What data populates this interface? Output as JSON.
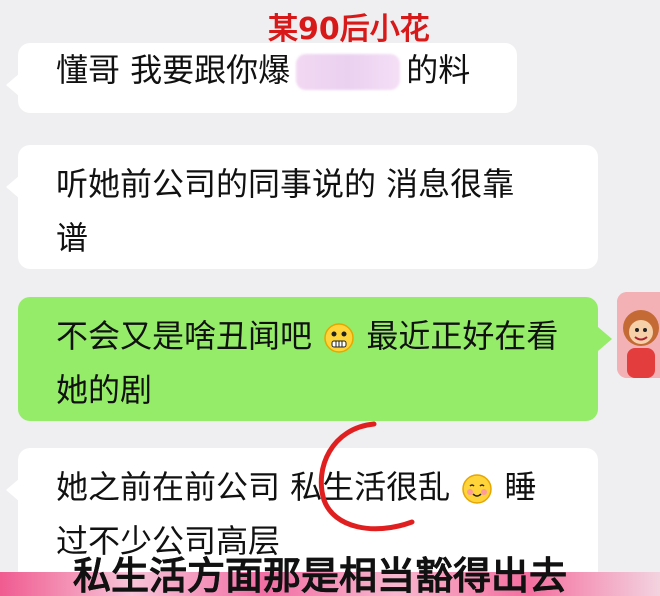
{
  "annotation": {
    "top_label": "某90后小花"
  },
  "messages": [
    {
      "sender": "other",
      "line1_a": "懂哥  我要跟你爆",
      "line1_b": "的料"
    },
    {
      "sender": "other",
      "line1": "听她前公司的同事说的  消息很靠",
      "line2": "谱"
    },
    {
      "sender": "self",
      "line1_a": "不会又是啥丑闻吧",
      "line1_b": "最近正好在看",
      "line2": "她的剧"
    },
    {
      "sender": "other",
      "line1_a": "她之前在前公司  私生活很乱",
      "line1_b": "睡",
      "line2": "过不少公司高层"
    }
  ],
  "caption": {
    "text": "私生活方面那是相当豁得出去"
  },
  "colors": {
    "self_bubble": "#95ec69",
    "other_bubble": "#ffffff",
    "annotation": "#d81919",
    "caption": "#111111"
  },
  "icons": {
    "emoji_1": "grimace-emoji-icon",
    "emoji_2": "blush-emoji-icon",
    "avatar": "monkey-avatar-icon",
    "red_mark": "red-circle-mark-icon"
  }
}
